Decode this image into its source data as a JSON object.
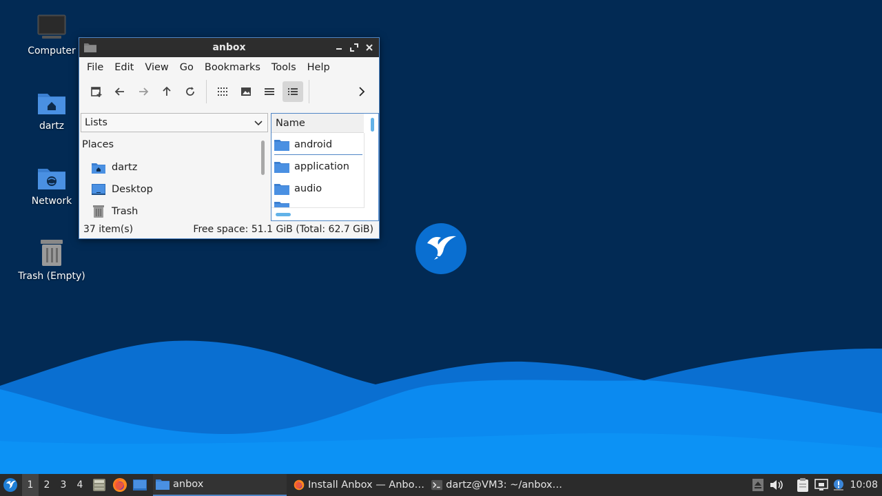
{
  "desktop": {
    "icons": [
      {
        "label": "Computer",
        "icon": "computer-icon"
      },
      {
        "label": "dartz",
        "icon": "home-folder-icon"
      },
      {
        "label": "Network",
        "icon": "network-folder-icon"
      },
      {
        "label": "Trash (Empty)",
        "icon": "trash-icon"
      }
    ],
    "logo": "hummingbird-logo"
  },
  "window": {
    "title": "anbox",
    "menu": [
      "File",
      "Edit",
      "View",
      "Go",
      "Bookmarks",
      "Tools",
      "Help"
    ],
    "toolbar": [
      "new-tab-icon",
      "back-icon",
      "forward-icon",
      "up-icon",
      "reload-icon",
      "icon-view-icon",
      "thumbnail-view-icon",
      "compact-view-icon",
      "detailed-list-view-icon",
      "more-chevron-icon"
    ],
    "side_pane": {
      "selector": "Lists",
      "places_header": "Places",
      "places": [
        {
          "label": "dartz",
          "icon": "home-folder-icon"
        },
        {
          "label": "Desktop",
          "icon": "desktop-icon"
        },
        {
          "label": "Trash",
          "icon": "trash-icon"
        }
      ]
    },
    "file_pane": {
      "column": "Name",
      "files": [
        "android",
        "application",
        "audio"
      ]
    },
    "status": {
      "items": "37 item(s)",
      "free_space": "Free space: 51.1 GiB (Total: 62.7 GiB)"
    }
  },
  "taskbar": {
    "workspaces": [
      "1",
      "2",
      "3",
      "4"
    ],
    "active_workspace": "1",
    "launchers": [
      "file-manager-icon",
      "firefox-icon",
      "show-desktop-icon"
    ],
    "tasks": [
      {
        "label": "anbox",
        "icon": "folder-icon"
      },
      {
        "label": "Install Anbox — Anbo…",
        "icon": "firefox-icon"
      },
      {
        "label": "dartz@VM3: ~/anbox…",
        "icon": "terminal-icon"
      }
    ],
    "tray": [
      "eject-icon",
      "volume-icon",
      "clipboard-icon",
      "network-icon",
      "notification-icon"
    ],
    "clock": "10:08"
  }
}
